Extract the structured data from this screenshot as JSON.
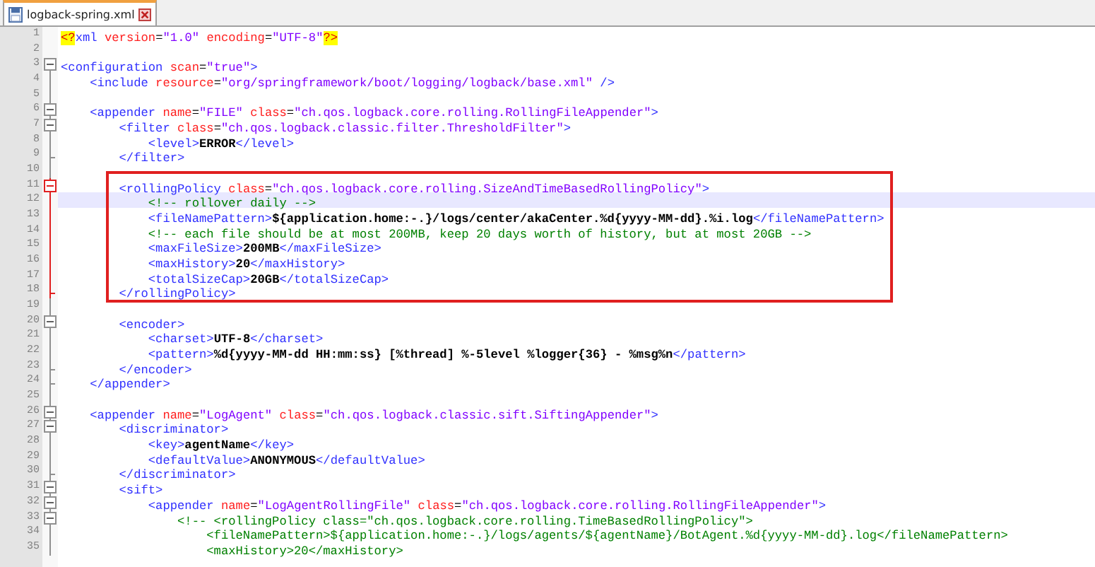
{
  "tabs": [
    {
      "label": "logback-spring.xml",
      "selected": true
    }
  ],
  "lines": [
    {
      "number": "1",
      "parts": [
        {
          "kind": "pi",
          "text": "<?"
        },
        {
          "kind": "tag",
          "text": "xml"
        },
        {
          "kind": "attr",
          "text": " version"
        },
        {
          "kind": "plain",
          "text": "="
        },
        {
          "kind": "value",
          "text": "\"1.0\""
        },
        {
          "kind": "attr",
          "text": " encoding"
        },
        {
          "kind": "plain",
          "text": "="
        },
        {
          "kind": "value",
          "text": "\"UTF-8\""
        },
        {
          "kind": "pi",
          "text": "?>"
        }
      ]
    },
    {
      "number": "2"
    },
    {
      "number": "3",
      "expanded": true,
      "parts": [
        {
          "kind": "tag",
          "text": "<configuration"
        },
        {
          "kind": "attr",
          "text": " scan"
        },
        {
          "kind": "plain",
          "text": "="
        },
        {
          "kind": "value",
          "text": "\"true\""
        },
        {
          "kind": "tag",
          "text": ">"
        }
      ]
    },
    {
      "number": "4",
      "parts": [
        {
          "kind": "tag",
          "text": "    <include"
        },
        {
          "kind": "attr",
          "text": " resource"
        },
        {
          "kind": "plain",
          "text": "="
        },
        {
          "kind": "value",
          "text": "\"org/springframework/boot/logging/logback/base.xml\""
        },
        {
          "kind": "tag",
          "text": " />"
        }
      ]
    },
    {
      "number": "5"
    },
    {
      "number": "6",
      "expanded": true,
      "parts": [
        {
          "kind": "tag",
          "text": "    <appender"
        },
        {
          "kind": "attr",
          "text": " name"
        },
        {
          "kind": "plain",
          "text": "="
        },
        {
          "kind": "value",
          "text": "\"FILE\""
        },
        {
          "kind": "attr",
          "text": " class"
        },
        {
          "kind": "plain",
          "text": "="
        },
        {
          "kind": "value",
          "text": "\"ch.qos.logback.core.rolling.RollingFileAppender\""
        },
        {
          "kind": "tag",
          "text": ">"
        }
      ]
    },
    {
      "number": "7",
      "expanded": true,
      "parts": [
        {
          "kind": "tag",
          "text": "        <filter"
        },
        {
          "kind": "attr",
          "text": " class"
        },
        {
          "kind": "plain",
          "text": "="
        },
        {
          "kind": "value",
          "text": "\"ch.qos.logback.classic.filter.ThresholdFilter\""
        },
        {
          "kind": "tag",
          "text": ">"
        }
      ]
    },
    {
      "number": "8",
      "parts": [
        {
          "kind": "tag",
          "text": "            <level>"
        },
        {
          "kind": "text",
          "text": "ERROR"
        },
        {
          "kind": "tag",
          "text": "</level>"
        }
      ]
    },
    {
      "number": "9",
      "block_end": true,
      "parts": [
        {
          "kind": "tag",
          "text": "        </filter>"
        }
      ]
    },
    {
      "number": "10"
    },
    {
      "number": "11",
      "expanded": true,
      "boxed": true,
      "parts": [
        {
          "kind": "tag",
          "text": "        <rollingPolicy"
        },
        {
          "kind": "attr",
          "text": " class"
        },
        {
          "kind": "plain",
          "text": "="
        },
        {
          "kind": "value",
          "text": "\"ch.qos.logback.core.rolling.SizeAndTimeBasedRollingPolicy\""
        },
        {
          "kind": "tag",
          "text": ">"
        }
      ]
    },
    {
      "number": "12",
      "boxed": true,
      "current": true,
      "parts": [
        {
          "kind": "comment",
          "text": "            <!-- rollover daily -->"
        }
      ]
    },
    {
      "number": "13",
      "boxed": true,
      "parts": [
        {
          "kind": "tag",
          "text": "            <fileNamePattern>"
        },
        {
          "kind": "text",
          "text": "${application.home:-.}/logs/center/akaCenter.%d{yyyy-MM-dd}.%i.log"
        },
        {
          "kind": "tag",
          "text": "</fileNamePattern>"
        }
      ]
    },
    {
      "number": "14",
      "boxed": true,
      "parts": [
        {
          "kind": "comment",
          "text": "            <!-- each file should be at most 200MB, keep 20 days worth of history, but at most 20GB -->"
        }
      ]
    },
    {
      "number": "15",
      "boxed": true,
      "parts": [
        {
          "kind": "tag",
          "text": "            <maxFileSize>"
        },
        {
          "kind": "text",
          "text": "200MB"
        },
        {
          "kind": "tag",
          "text": "</maxFileSize>"
        }
      ]
    },
    {
      "number": "16",
      "boxed": true,
      "parts": [
        {
          "kind": "tag",
          "text": "            <maxHistory>"
        },
        {
          "kind": "text",
          "text": "20"
        },
        {
          "kind": "tag",
          "text": "</maxHistory>"
        }
      ]
    },
    {
      "number": "17",
      "boxed": true,
      "parts": [
        {
          "kind": "tag",
          "text": "            <totalSizeCap>"
        },
        {
          "kind": "text",
          "text": "20GB"
        },
        {
          "kind": "tag",
          "text": "</totalSizeCap>"
        }
      ]
    },
    {
      "number": "18",
      "block_end": true,
      "boxed": true,
      "parts": [
        {
          "kind": "tag",
          "text": "        </rollingPolicy>"
        }
      ]
    },
    {
      "number": "19"
    },
    {
      "number": "20",
      "expanded": true,
      "parts": [
        {
          "kind": "tag",
          "text": "        <encoder>"
        }
      ]
    },
    {
      "number": "21",
      "parts": [
        {
          "kind": "tag",
          "text": "            <charset>"
        },
        {
          "kind": "text",
          "text": "UTF-8"
        },
        {
          "kind": "tag",
          "text": "</charset>"
        }
      ]
    },
    {
      "number": "22",
      "parts": [
        {
          "kind": "tag",
          "text": "            <pattern>"
        },
        {
          "kind": "text",
          "text": "%d{yyyy-MM-dd HH:mm:ss} [%thread] %-5level %logger{36} - %msg%n"
        },
        {
          "kind": "tag",
          "text": "</pattern>"
        }
      ]
    },
    {
      "number": "23",
      "block_end": true,
      "parts": [
        {
          "kind": "tag",
          "text": "        </encoder>"
        }
      ]
    },
    {
      "number": "24",
      "block_end": true,
      "parts": [
        {
          "kind": "tag",
          "text": "    </appender>"
        }
      ]
    },
    {
      "number": "25"
    },
    {
      "number": "26",
      "expanded": true,
      "parts": [
        {
          "kind": "tag",
          "text": "    <appender"
        },
        {
          "kind": "attr",
          "text": " name"
        },
        {
          "kind": "plain",
          "text": "="
        },
        {
          "kind": "value",
          "text": "\"LogAgent\""
        },
        {
          "kind": "attr",
          "text": " class"
        },
        {
          "kind": "plain",
          "text": "="
        },
        {
          "kind": "value",
          "text": "\"ch.qos.logback.classic.sift.SiftingAppender\""
        },
        {
          "kind": "tag",
          "text": ">"
        }
      ]
    },
    {
      "number": "27",
      "expanded": true,
      "parts": [
        {
          "kind": "tag",
          "text": "        <discriminator>"
        }
      ]
    },
    {
      "number": "28",
      "parts": [
        {
          "kind": "tag",
          "text": "            <key>"
        },
        {
          "kind": "text",
          "text": "agentName"
        },
        {
          "kind": "tag",
          "text": "</key>"
        }
      ]
    },
    {
      "number": "29",
      "parts": [
        {
          "kind": "tag",
          "text": "            <defaultValue>"
        },
        {
          "kind": "text",
          "text": "ANONYMOUS"
        },
        {
          "kind": "tag",
          "text": "</defaultValue>"
        }
      ]
    },
    {
      "number": "30",
      "block_end": true,
      "parts": [
        {
          "kind": "tag",
          "text": "        </discriminator>"
        }
      ]
    },
    {
      "number": "31",
      "expanded": true,
      "parts": [
        {
          "kind": "tag",
          "text": "        <sift>"
        }
      ]
    },
    {
      "number": "32",
      "expanded": true,
      "parts": [
        {
          "kind": "tag",
          "text": "            <appender"
        },
        {
          "kind": "attr",
          "text": " name"
        },
        {
          "kind": "plain",
          "text": "="
        },
        {
          "kind": "value",
          "text": "\"LogAgentRollingFile\""
        },
        {
          "kind": "attr",
          "text": " class"
        },
        {
          "kind": "plain",
          "text": "="
        },
        {
          "kind": "value",
          "text": "\"ch.qos.logback.core.rolling.RollingFileAppender\""
        },
        {
          "kind": "tag",
          "text": ">"
        }
      ]
    },
    {
      "number": "33",
      "expanded": true,
      "parts": [
        {
          "kind": "comment",
          "text": "                <!-- <rollingPolicy class=\"ch.qos.logback.core.rolling.TimeBasedRollingPolicy\">"
        }
      ]
    },
    {
      "number": "34",
      "parts": [
        {
          "kind": "comment",
          "text": "                    <fileNamePattern>${application.home:-.}/logs/agents/${agentName}/BotAgent.%d{yyyy-MM-dd}.log</fileNamePattern>"
        }
      ]
    },
    {
      "number": "35",
      "parts": [
        {
          "kind": "comment",
          "text": "                    <maxHistory>20</maxHistory>"
        }
      ]
    }
  ]
}
